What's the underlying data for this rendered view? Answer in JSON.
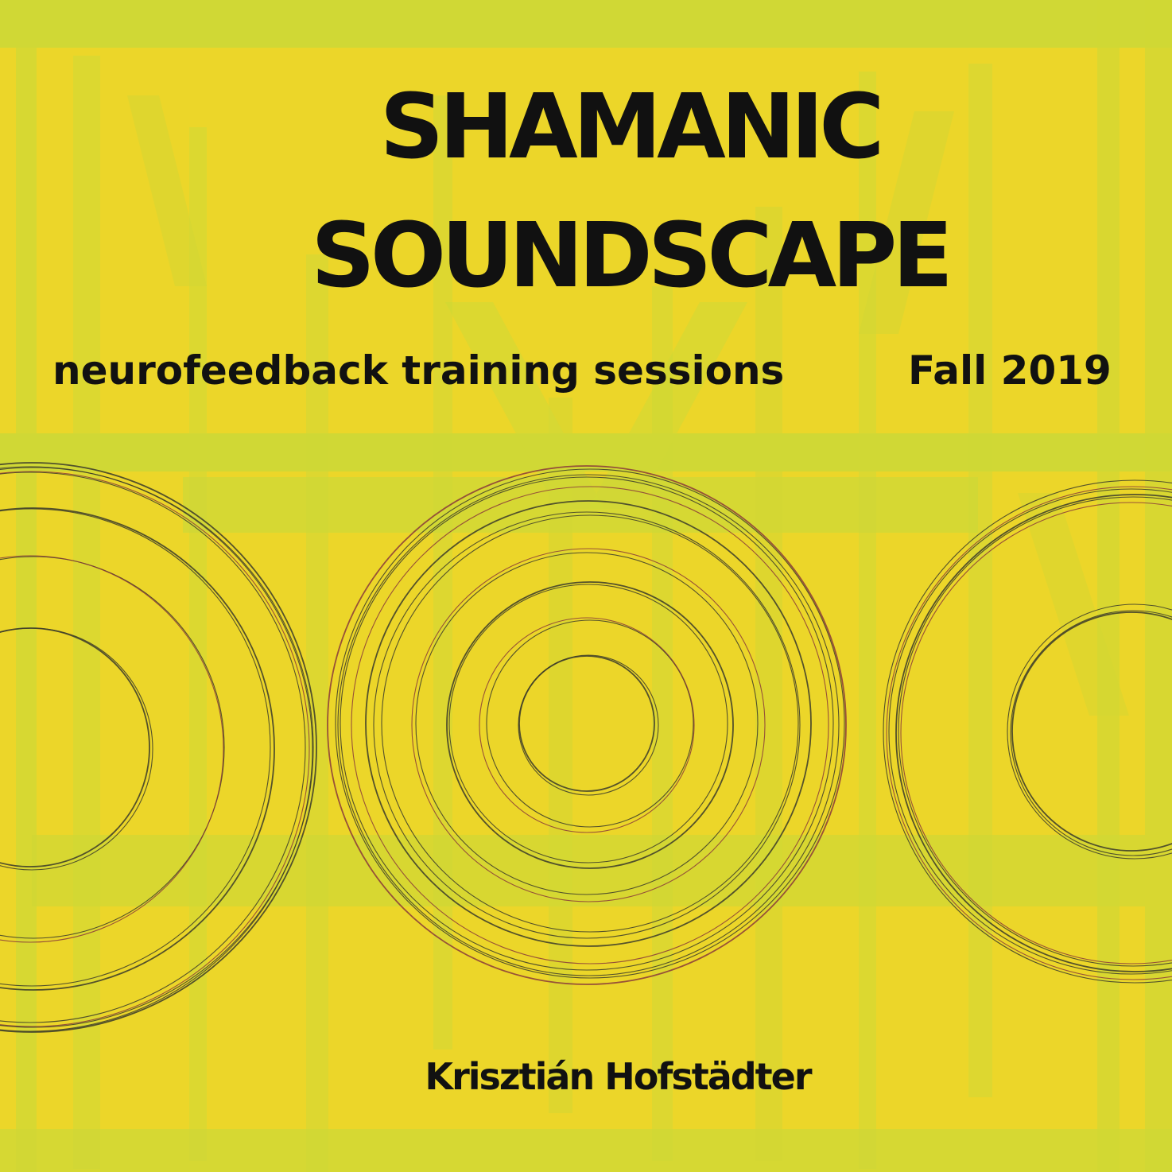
{
  "cover": {
    "title_line_1": "SHAMANIC",
    "title_line_2": "SOUNDSCAPE",
    "subtitle": "neurofeedback training sessions",
    "season": "Fall 2019",
    "author": "Krisztián Hofstädter"
  },
  "colors": {
    "background": "#ecd629",
    "brush": "#c9d63a",
    "text": "#111111",
    "ring_dark": "#3a3a2a",
    "ring_red": "#8a3a3a"
  }
}
